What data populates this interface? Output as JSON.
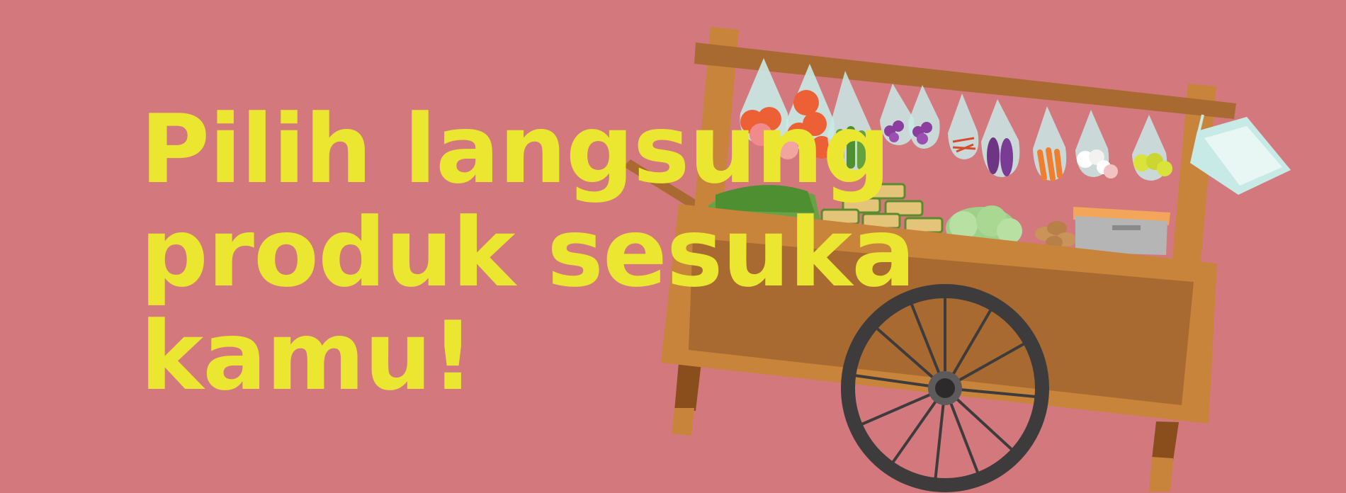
{
  "banner": {
    "headline_lines": [
      "Pilih langsung",
      "produk sesuka",
      "kamu!"
    ]
  },
  "colors": {
    "background": "#d3797e",
    "headline": "#ebe731",
    "cart_light_wood": "#c8843a",
    "cart_dark_wood": "#a86a30",
    "wheel": "#3d3b3b"
  },
  "illustration": {
    "subject": "vegetable-cart",
    "icons": [
      "tomato-bags",
      "chili-bag",
      "cucumber-bags",
      "eggplant-bags",
      "shallot-bags",
      "carrot-bag",
      "garlic-bags",
      "lime-bags",
      "spinach-bundle",
      "tempeh-stack",
      "cabbage",
      "potato-pile",
      "steel-tray",
      "egg-tray-bag",
      "cart-wheel"
    ]
  }
}
